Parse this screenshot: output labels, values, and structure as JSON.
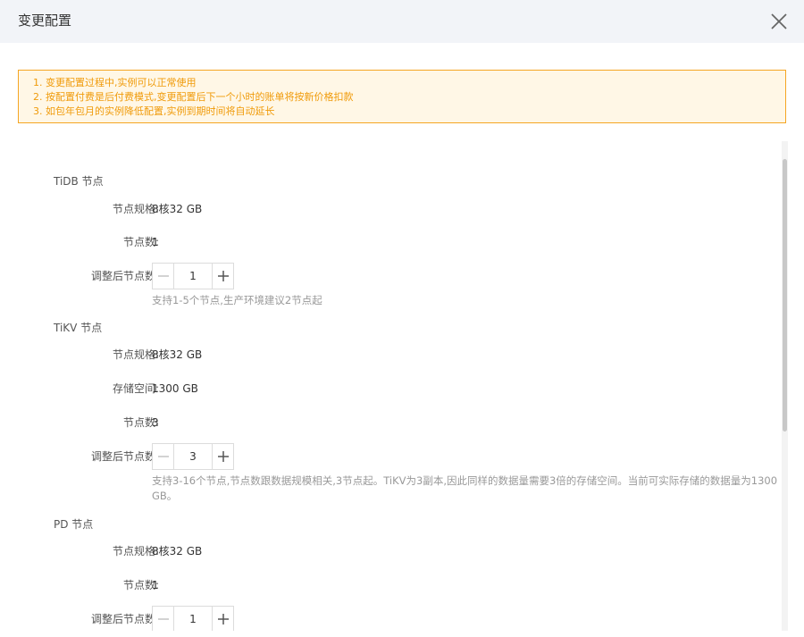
{
  "dialog": {
    "title": "变更配置"
  },
  "notice": {
    "lines": [
      "1. 变更配置过程中,实例可以正常使用",
      "2. 按配置付费是后付费模式,变更配置后下一个小时的账单将按新价格扣款",
      "3. 如包年包月的实例降低配置,实例到期时间将自动延长"
    ]
  },
  "sections": [
    {
      "title": "TiDB 节点",
      "spec_label": "节点规格:",
      "spec_value": "8核32 GB",
      "count_label": "节点数:",
      "count_value": "1",
      "adjust_label": "调整后节点数:",
      "adjust_value": "1",
      "hint": "支持1-5个节点,生产环境建议2节点起"
    },
    {
      "title": "TiKV 节点",
      "spec_label": "节点规格:",
      "spec_value": "8核32 GB",
      "storage_label": "存储空间:",
      "storage_value": "1300 GB",
      "count_label": "节点数:",
      "count_value": "3",
      "adjust_label": "调整后节点数:",
      "adjust_value": "3",
      "hint": "支持3-16个节点,节点数跟数据规模相关,3节点起。TiKV为3副本,因此同样的数据量需要3倍的存储空间。当前可实际存储的数据量为1300 GB。"
    },
    {
      "title": "PD 节点",
      "spec_label": "节点规格:",
      "spec_value": "8核32 GB",
      "count_label": "节点数:",
      "count_value": "1",
      "adjust_label": "调整后节点数:",
      "adjust_value": "1"
    }
  ],
  "icons": {
    "close": "close-icon",
    "minus": "minus-icon",
    "plus": "plus-icon"
  },
  "colors": {
    "notice_text": "#f09b0a",
    "notice_border": "#f5a623",
    "notice_bg": "#fff7e6",
    "header_bg": "#f2f4f8"
  }
}
